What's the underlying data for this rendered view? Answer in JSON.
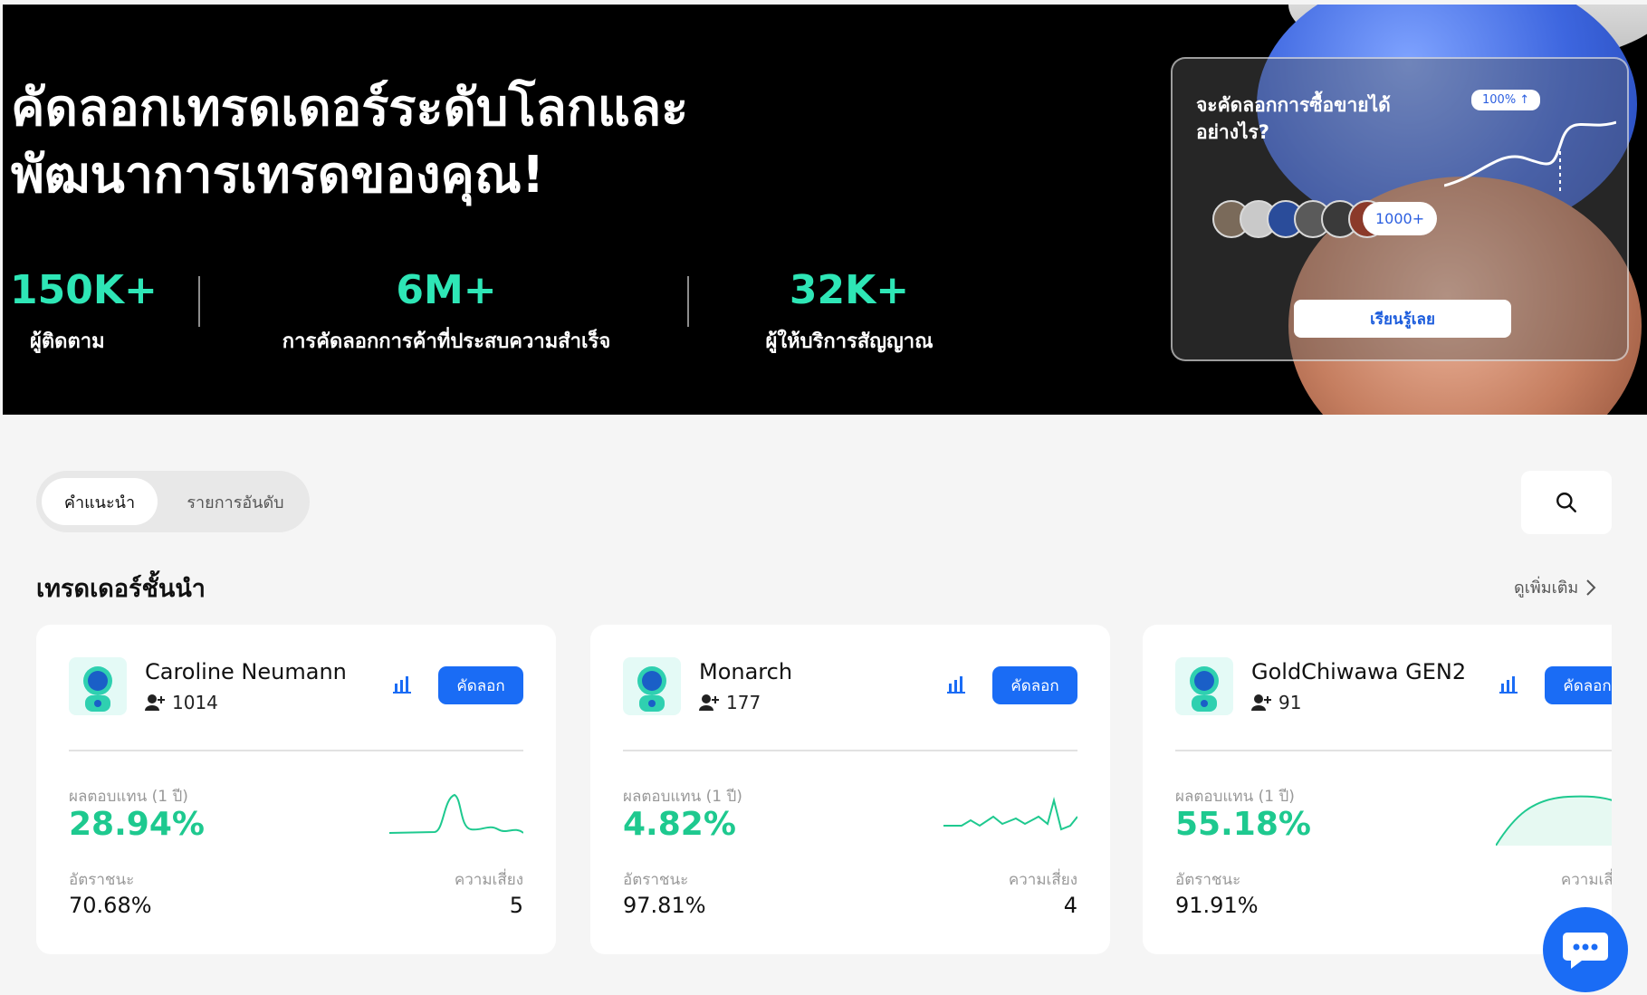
{
  "hero": {
    "title_line1": "คัดลอกเทรดเดอร์ระดับโลกและ",
    "title_line2": "พัฒนาการเทรดของคุณ!",
    "stats": [
      {
        "value": "150K+",
        "label": "ผู้ติดตาม"
      },
      {
        "value": "6M+",
        "label": "การคัดลอกการค้าที่ประสบความสำเร็จ"
      },
      {
        "value": "32K+",
        "label": "ผู้ให้บริการสัญญาณ"
      }
    ],
    "card": {
      "title_line1": "จะคัดลอกการซื้อขายได้",
      "title_line2": "อย่างไร?",
      "percent_badge": "100% ↑",
      "count_badge": "1000+",
      "button": "เรียนรู้เลย"
    }
  },
  "tabs": {
    "recommend": "คำแนะนำ",
    "ranking": "รายการอันดับ"
  },
  "section": {
    "title": "เทรดเดอร์ชั้นนำ",
    "see_more": "ดูเพิ่มเติม"
  },
  "traders": [
    {
      "name": "Caroline Neumann",
      "followers": "1014",
      "copy_label": "คัดลอก",
      "return_label": "ผลตอบแทน (1 ปี)",
      "return_value": "28.94%",
      "winrate_label": "อัตราชนะ",
      "winrate_value": "70.68%",
      "risk_label": "ความเสี่ยง",
      "risk_value": "5"
    },
    {
      "name": "Monarch",
      "followers": "177",
      "copy_label": "คัดลอก",
      "return_label": "ผลตอบแทน (1 ปี)",
      "return_value": "4.82%",
      "winrate_label": "อัตราชนะ",
      "winrate_value": "97.81%",
      "risk_label": "ความเสี่ยง",
      "risk_value": "4"
    },
    {
      "name": "GoldChiwawa GEN2",
      "followers": "91",
      "copy_label": "คัดลอก",
      "return_label": "ผลตอบแทน (1 ปี)",
      "return_value": "55.18%",
      "winrate_label": "อัตราชนะ",
      "winrate_value": "91.91%",
      "risk_label": "ความเสี่ยง",
      "risk_value": ""
    }
  ],
  "colors": {
    "accent": "#1a6cf5",
    "stat_green": "#2ee6b6",
    "return_green": "#1ec98f"
  },
  "icons": [
    "search-icon",
    "chevron-right-icon",
    "follower-icon",
    "bar-chart-icon",
    "trader-avatar-icon",
    "chat-icon",
    "trend-up-icon"
  ]
}
